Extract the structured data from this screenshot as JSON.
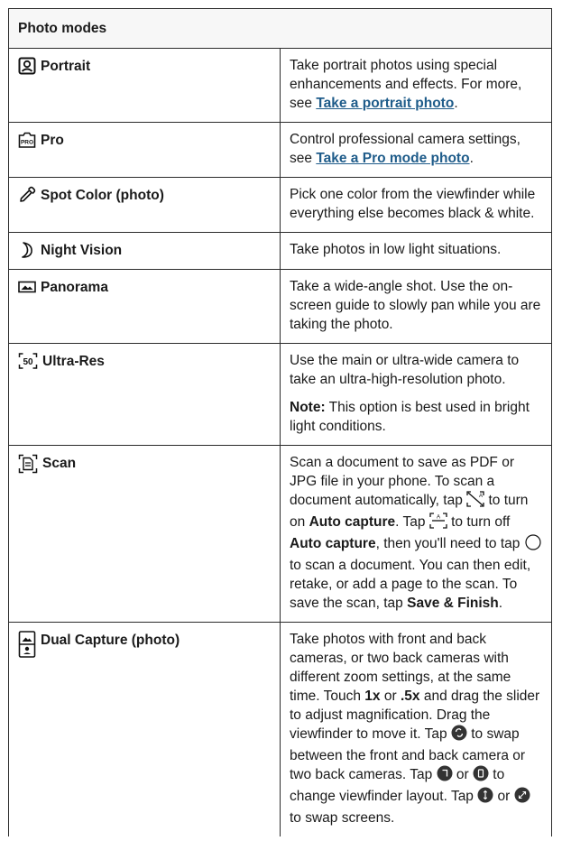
{
  "header": "Photo modes",
  "rows": {
    "portrait": {
      "name": "Portrait",
      "icon": "portrait-icon",
      "desc_pre": "Take portrait photos using special enhancements and effects. For more, see ",
      "link": "Take a portrait photo",
      "desc_post": "."
    },
    "pro": {
      "name": "Pro",
      "icon": "pro-icon",
      "desc_pre": "Control professional camera settings, see ",
      "link": "Take a Pro mode photo",
      "desc_post": "."
    },
    "spot_color": {
      "name": "Spot Color (photo)",
      "icon": "eyedropper-icon",
      "desc": "Pick one color from the viewfinder while everything else becomes black & white."
    },
    "night_vision": {
      "name": "Night Vision",
      "icon": "moon-icon",
      "desc": "Take photos in low light situations."
    },
    "panorama": {
      "name": "Panorama",
      "icon": "panorama-icon",
      "desc": "Take a wide-angle shot. Use the on-screen guide to slowly pan while you are taking the photo."
    },
    "ultra_res": {
      "name": "Ultra-Res",
      "icon": "ultra-res-icon",
      "icon_text": "50",
      "desc": "Use the main or ultra-wide camera to take an ultra-high-resolution photo.",
      "note_label": "Note:",
      "note_text": " This option is best used in bright light conditions."
    },
    "scan": {
      "name": "Scan",
      "icon": "scan-icon",
      "t1": "Scan a document to save as PDF or JPG file in your phone. To scan a document automatically, tap ",
      "t2": " to turn on ",
      "b1": "Auto capture",
      "t3": ". Tap ",
      "t4": " to turn off ",
      "b2": "Auto capture",
      "t5": ", then you'll need to tap ",
      "t6": " to scan a document. You can then edit, retake, or add a page to the scan. To save the scan, tap ",
      "b3": "Save & Finish",
      "t7": "."
    },
    "dual_capture": {
      "name": "Dual Capture (photo)",
      "icon": "dual-capture-icon",
      "t1": "Take photos with front and back cameras, or two back cameras with different zoom settings, at the same time. Touch ",
      "b1": "1x",
      "t2": " or ",
      "b2": ".5x",
      "t3": " and drag the slider to adjust magnification. Drag the viewfinder to move it. Tap ",
      "t4": " to swap between the front and back camera or two back cameras. Tap ",
      "t5": " or ",
      "t6": " to change viewfinder layout. Tap ",
      "t7": " or ",
      "t8": " to swap screens."
    }
  }
}
